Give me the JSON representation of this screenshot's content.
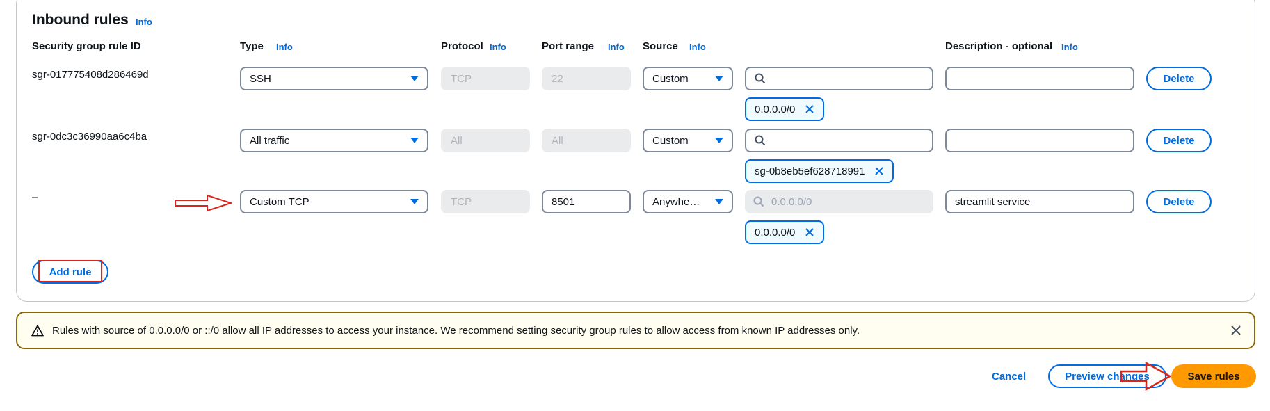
{
  "section": {
    "title": "Inbound rules",
    "title_info": "Info"
  },
  "columns": {
    "rule_id": "Security group rule ID",
    "type": "Type",
    "type_info": "Info",
    "protocol": "Protocol",
    "protocol_info": "Info",
    "port_range": "Port range",
    "port_range_info": "Info",
    "source": "Source",
    "source_info": "Info",
    "description": "Description - optional",
    "description_info": "Info"
  },
  "rules": [
    {
      "rule_id": "sgr-017775408d286469d",
      "type": "SSH",
      "protocol": "TCP",
      "port_range": "22",
      "source": "Custom",
      "search_placeholder": "",
      "token": "0.0.0.0/0",
      "description": "",
      "delete_label": "Delete"
    },
    {
      "rule_id": "sgr-0dc3c36990aa6c4ba",
      "type": "All traffic",
      "protocol": "All",
      "port_range": "All",
      "source": "Custom",
      "search_placeholder": "",
      "token": "sg-0b8eb5ef628718991",
      "description": "",
      "delete_label": "Delete"
    },
    {
      "rule_id": "–",
      "type": "Custom TCP",
      "protocol": "TCP",
      "port_range": "8501",
      "source": "Anywhe…",
      "search_placeholder": "0.0.0.0/0",
      "token": "0.0.0.0/0",
      "description": "streamlit service",
      "delete_label": "Delete"
    }
  ],
  "add_rule_label": "Add rule",
  "warning": {
    "message": "Rules with source of 0.0.0.0/0 or ::/0 allow all IP addresses to access your instance. We recommend setting security group rules to allow access from known IP addresses only."
  },
  "footer": {
    "cancel_label": "Cancel",
    "preview_label": "Preview changes",
    "save_label": "Save rules"
  },
  "colors": {
    "accent": "#006ce0",
    "primary_button": "#ff9900",
    "warning_border": "#8d6605",
    "annotation": "#d8261c"
  }
}
